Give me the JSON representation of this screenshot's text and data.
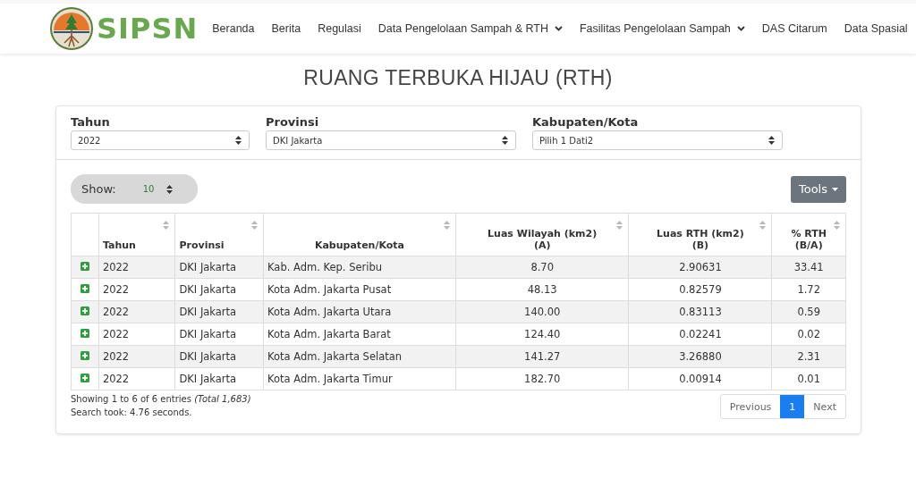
{
  "header": {
    "logo_text": "SIPSN",
    "nav": [
      {
        "label": "Beranda",
        "kind": "link"
      },
      {
        "label": "Berita",
        "kind": "link"
      },
      {
        "label": "Regulasi",
        "kind": "link"
      },
      {
        "label": "Data Pengelolaan Sampah & RTH",
        "kind": "dropdown"
      },
      {
        "label": "Fasilitas Pengelolaan Sampah",
        "kind": "dropdown"
      },
      {
        "label": "DAS Citarum",
        "kind": "link"
      },
      {
        "label": "Data Spasial",
        "kind": "link"
      }
    ]
  },
  "page_title": "RUANG TERBUKA HIJAU (RTH)",
  "filters": [
    {
      "label": "Tahun",
      "value": "2022"
    },
    {
      "label": "Provinsi",
      "value": "DKI Jakarta"
    },
    {
      "label": "Kabupaten/Kota",
      "value": "Pilih 1 Dati2"
    }
  ],
  "show": {
    "label": "Show:",
    "value": "10"
  },
  "tools_button": "Tools",
  "table": {
    "columns": [
      "Tahun",
      "Provinsi",
      "Kabupaten/Kota",
      "Luas Wilayah (km2)\n(A)",
      "Luas RTH (km2)\n(B)",
      "% RTH\n(B/A)"
    ],
    "rows": [
      [
        "2022",
        "DKI Jakarta",
        "Kab. Adm. Kep. Seribu",
        "8.70",
        "2.90631",
        "33.41"
      ],
      [
        "2022",
        "DKI Jakarta",
        "Kota Adm. Jakarta Pusat",
        "48.13",
        "0.82579",
        "1.72"
      ],
      [
        "2022",
        "DKI Jakarta",
        "Kota Adm. Jakarta Utara",
        "140.00",
        "0.83113",
        "0.59"
      ],
      [
        "2022",
        "DKI Jakarta",
        "Kota Adm. Jakarta Barat",
        "124.40",
        "0.02241",
        "0.02"
      ],
      [
        "2022",
        "DKI Jakarta",
        "Kota Adm. Jakarta Selatan",
        "141.27",
        "3.26880",
        "2.31"
      ],
      [
        "2022",
        "DKI Jakarta",
        "Kota Adm. Jakarta Timur",
        "182.70",
        "0.00914",
        "0.01"
      ]
    ]
  },
  "info": "Showing 1 to 6 of 6 entries *(Total 1,683)*",
  "search_time": "Search took: 4.76 seconds.",
  "pagination": [
    {
      "label": "Previous",
      "selected": false
    },
    {
      "label": "1",
      "selected": true
    },
    {
      "label": "Next",
      "selected": false
    }
  ]
}
